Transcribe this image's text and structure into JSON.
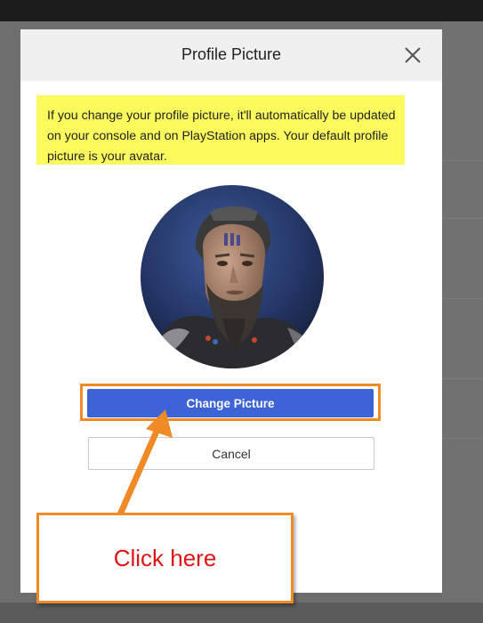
{
  "dialog": {
    "title": "Profile Picture",
    "notice": "If you change your profile picture, it'll automatically be updated on your console and on PlayStation apps. Your default profile picture is your avatar.",
    "close_icon": "close-x-icon",
    "change_button": "Change Picture",
    "cancel_button": "Cancel"
  },
  "annotation": {
    "callout_text": "Click here"
  },
  "colors": {
    "primary_button": "#3d64d6",
    "highlight": "#fbfb5e",
    "annotation_orange": "#f08a24",
    "callout_text": "#e01414"
  }
}
